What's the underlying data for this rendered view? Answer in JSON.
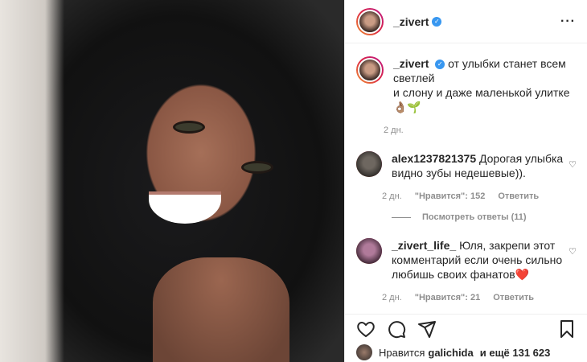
{
  "post": {
    "username": "_zivert",
    "verified_icon": "verified-badge-icon",
    "more_icon": "more-options-icon"
  },
  "caption": {
    "username": "_zivert",
    "text": "от улыбки станет всем светлей\nи слону и даже маленькой улитке 👌🏽🌱",
    "time": "2 дн."
  },
  "comments": [
    {
      "username": "alex1237821375",
      "text": "Дорогая улыбка видно зубы недешевые)).",
      "time": "2 дн.",
      "likes": "\"Нравится\": 152",
      "reply": "Ответить",
      "view_replies": "Посмотреть ответы (11)"
    },
    {
      "username": "_zivert_life_",
      "text": "Юля, закрепи этот комментарий если очень сильно любишь своих фанатов❤️",
      "time": "2 дн.",
      "likes": "\"Нравится\": 21",
      "reply": "Ответить"
    }
  ],
  "likes_line": {
    "prefix": "Нравится",
    "user": "galichida",
    "suffix": "и ещё 131 623"
  },
  "colors": {
    "verified": "#3897f0",
    "like_heart": "#ed4956"
  }
}
